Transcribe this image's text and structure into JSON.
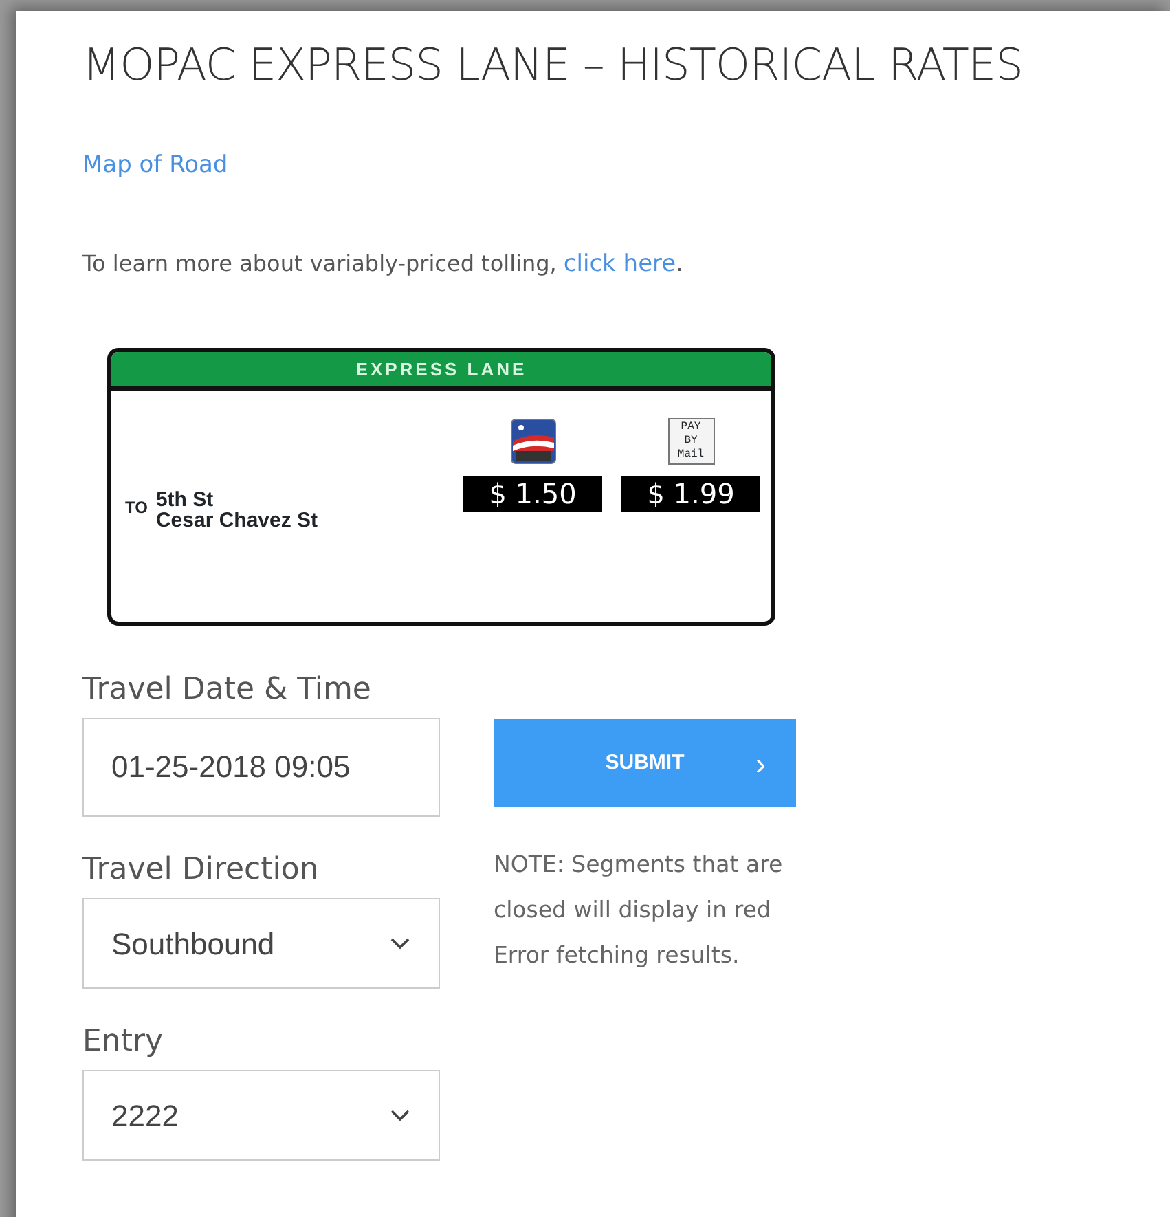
{
  "title": "MOPAC EXPRESS LANE – HISTORICAL RATES",
  "map_link": "Map of Road",
  "info": {
    "text": "To learn more about variably-priced tolling, ",
    "link": "click here",
    "end": "."
  },
  "sign": {
    "header": "EXPRESS LANE",
    "to": "TO",
    "destinations": [
      "5th St",
      "Cesar Chavez St"
    ],
    "rates": [
      {
        "kind": "tag",
        "price": "$ 1.50"
      },
      {
        "kind": "mail",
        "icon_lines": [
          "PAY BY",
          "Mail"
        ],
        "price": "$ 1.99"
      }
    ]
  },
  "form": {
    "date_label": "Travel Date & Time",
    "date_value": "01-25-2018 09:05",
    "direction_label": "Travel Direction",
    "direction_value": "Southbound",
    "entry_label": "Entry",
    "entry_value": "2222"
  },
  "submit": {
    "label": "SUBMIT",
    "arrow": "›"
  },
  "notes": [
    "NOTE: Segments that are closed will display in red",
    "Error fetching results."
  ]
}
